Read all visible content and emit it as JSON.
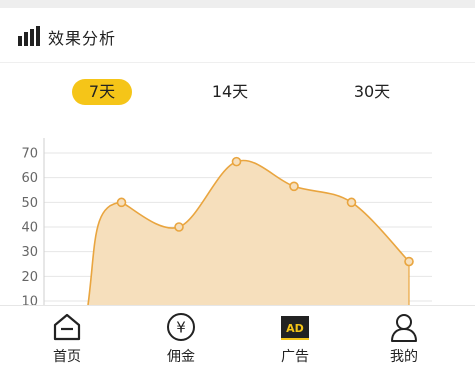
{
  "header": {
    "title": "效果分析",
    "icon": "bar-chart-icon"
  },
  "tabs": [
    {
      "label": "7天",
      "active": true
    },
    {
      "label": "14天",
      "active": false
    },
    {
      "label": "30天",
      "active": false
    }
  ],
  "chart_data": {
    "type": "area",
    "title": "",
    "xlabel": "",
    "ylabel": "",
    "y_ticks": [
      "70",
      "60",
      "50",
      "40",
      "30",
      "20",
      "10"
    ],
    "ylim": [
      10,
      70
    ],
    "x": [
      1,
      2,
      3,
      4,
      5,
      6,
      7
    ],
    "series": [
      {
        "values": [
          50,
          40,
          66.5,
          56.5,
          50,
          26
        ]
      }
    ],
    "colors": {
      "fill": "#f6dfbc",
      "line": "#e9a53f",
      "grid": "#e6e6e6"
    },
    "grid": true
  },
  "bottom_nav": {
    "items": [
      {
        "label": "首页",
        "icon": "home-icon"
      },
      {
        "label": "佣金",
        "icon": "yen-icon"
      },
      {
        "label": "广告",
        "icon": "ad-icon",
        "badge": "AD"
      },
      {
        "label": "我的",
        "icon": "user-icon"
      }
    ]
  }
}
